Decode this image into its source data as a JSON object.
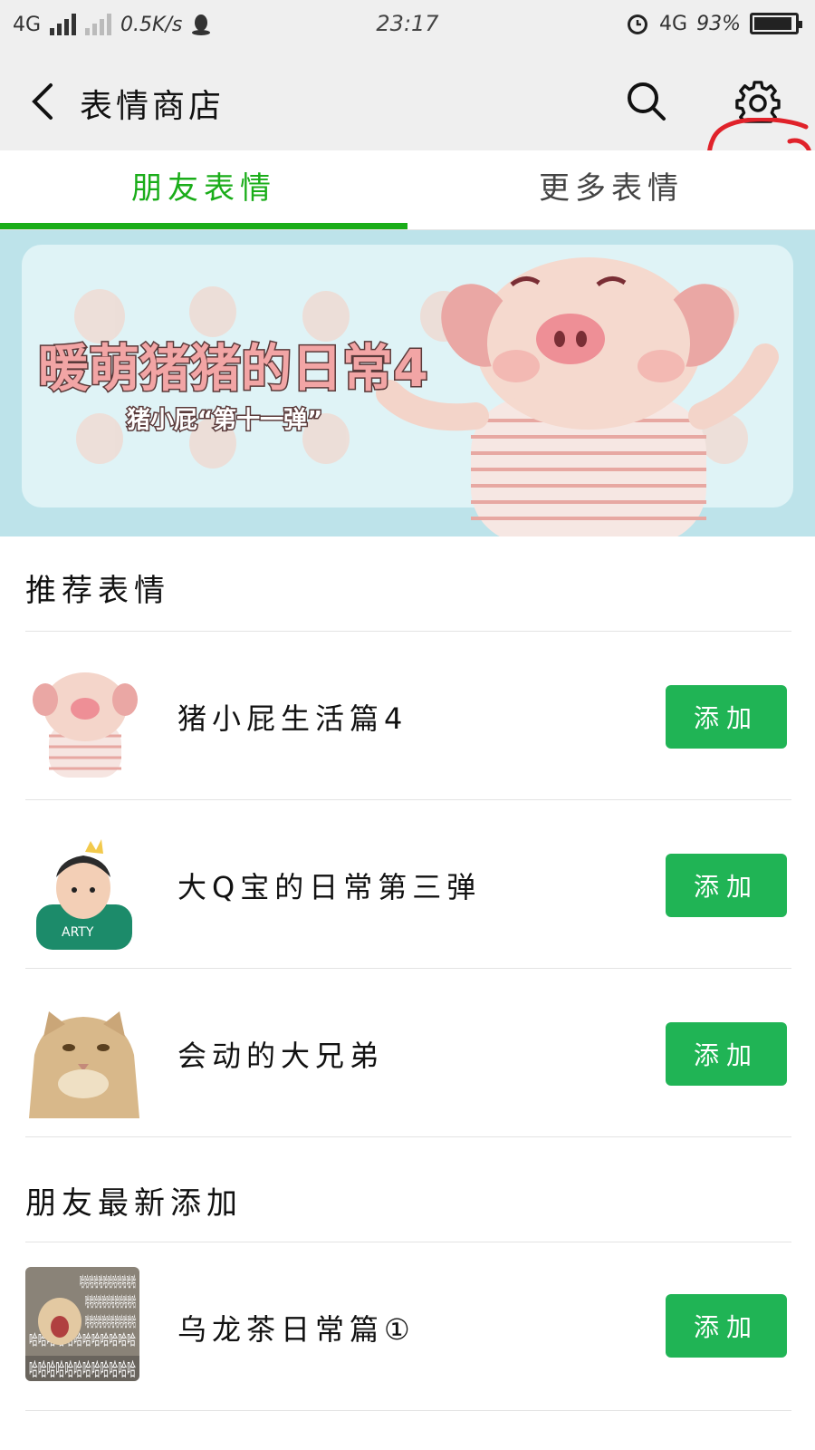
{
  "status_bar": {
    "network": "4G",
    "speed": "0.5K/s",
    "time": "23:17",
    "network_right": "4G",
    "battery_text": "93%",
    "battery_level": 0.93
  },
  "header": {
    "title": "表情商店",
    "back_icon": "chevron-left-icon",
    "search_icon": "search-icon",
    "settings_icon": "gear-icon"
  },
  "tabs": [
    {
      "label": "朋友表情",
      "active": true
    },
    {
      "label": "更多表情",
      "active": false
    }
  ],
  "banner": {
    "title": "暖萌猪猪的日常4",
    "subtitle": "猪小屁“第十一弹”"
  },
  "sections": {
    "recommended": {
      "title": "推荐表情",
      "items": [
        {
          "name": "猪小屁生活篇4",
          "button": "添加"
        },
        {
          "name": "大Q宝的日常第三弹",
          "button": "添加"
        },
        {
          "name": "会动的大兄弟",
          "button": "添加"
        }
      ]
    },
    "friends_latest": {
      "title": "朋友最新添加",
      "items": [
        {
          "name": "乌龙茶日常篇①",
          "button": "添加",
          "thumb_text": "哈哈哈哈哈哈哈哈哈哈哈哈"
        }
      ]
    }
  },
  "colors": {
    "accent": "#1aad19",
    "button": "#20b455",
    "annotation": "#e0222a"
  }
}
